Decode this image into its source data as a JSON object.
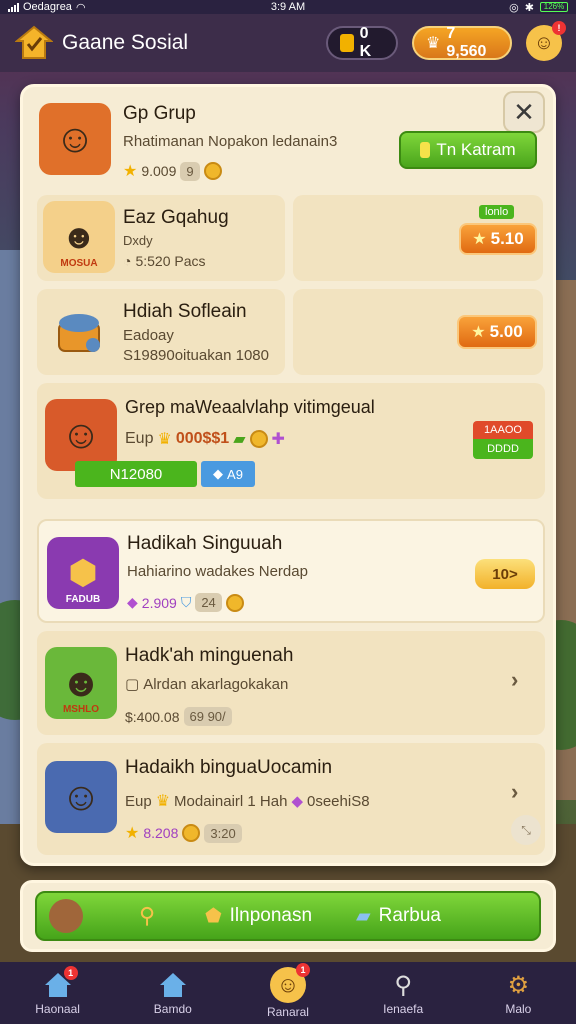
{
  "status": {
    "carrier": "Oedagrea",
    "time": "3:9 AM",
    "battery": "126%"
  },
  "topbar": {
    "title": "Gaane Sosial",
    "keys": "0 K",
    "gold": "7 9,560",
    "avatar_badge": "!"
  },
  "cards": [
    {
      "title": "Gp Grup",
      "subtitle": "Rhatimanan Nopakon ledanain3",
      "rating": "9.009",
      "chip": "9",
      "button": "Tn Katram"
    },
    {
      "title": "Eaz Gqahug",
      "line1": "Dxdy",
      "line2": "5:520 Pacs",
      "thumb_label": "MOSUA",
      "tag": "lonlo",
      "price": "5.10"
    },
    {
      "title": "Hdiah Sofleain",
      "line1": "Eadoay",
      "line2": "S19890oituakan 1080",
      "price": "5.00"
    },
    {
      "title": "Grep maWeaalvlahp vitimgeual",
      "line1_prefix": "Eup",
      "line1_value": "000$$1",
      "progress_label": "N12080",
      "tag_blue": "A9",
      "green_top": "1AAOO",
      "green_bottom": "DDDD"
    },
    {
      "title": "Hadikah Singuuah",
      "subtitle": "Hahiarino wadakes Nerdap",
      "gems": "2.909",
      "shield": "24",
      "thumb_label": "FADUB",
      "badge": "10>"
    },
    {
      "title": "Hadk'ah minguenah",
      "subtitle": "Alrdan akarlagokakan",
      "price_line": "$:400.08",
      "chip": "69 90/",
      "thumb_label": "MSHLO"
    },
    {
      "title": "Hadaikh binguaUocamin",
      "line1_prefix": "Eup",
      "line1_mid": "Modainairl 1 Hah",
      "line1_suffix": "0seehiS8",
      "rating": "8.208",
      "chip": "3:20"
    }
  ],
  "action_bar": {
    "search_label": "",
    "center_label": "Ilnponasn",
    "right_label": "Rarbua"
  },
  "nav": [
    {
      "label": "Haonaal",
      "badge": "1"
    },
    {
      "label": "Bamdo",
      "badge": ""
    },
    {
      "label": "Ranaral",
      "badge": "1"
    },
    {
      "label": "Ienaefa",
      "badge": ""
    },
    {
      "label": "Malo",
      "badge": ""
    }
  ],
  "colors": {
    "accent_green": "#4aa51c",
    "accent_orange": "#e06a12",
    "panel": "#f6ecd4",
    "topbar": "#3d2d4a"
  }
}
